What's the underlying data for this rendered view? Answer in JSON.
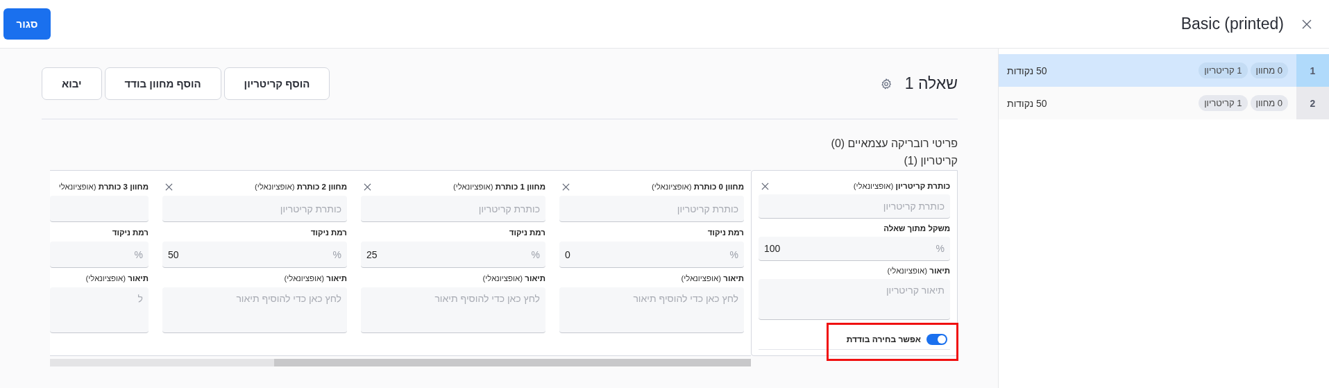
{
  "header": {
    "title": "Basic (printed)",
    "close_button": "סגור"
  },
  "sidebar": {
    "items": [
      {
        "number": "1",
        "tags": [
          "0 מחוון",
          "1 קריטריון"
        ],
        "points": "50 נקודות",
        "selected": true
      },
      {
        "number": "2",
        "tags": [
          "0 מחוון",
          "1 קריטריון"
        ],
        "points": "50 נקודות",
        "selected": false
      }
    ]
  },
  "question": {
    "title": "שאלה 1",
    "buttons": [
      "הוסף קריטריון",
      "הוסף מחוון בודד",
      "יבוא"
    ],
    "independent_items": "פריטי רובריקה עצמאיים (0)",
    "criteria_heading": "קריטריון (1)"
  },
  "criterion_card": {
    "fields": [
      {
        "kind": "text",
        "label": "כותרת קריטריון",
        "note": "(אופציונאלי)",
        "placeholder": "כותרת קריטריון"
      },
      {
        "kind": "percent",
        "label": "משקל מתוך שאלה",
        "value": "100",
        "unit": "%"
      },
      {
        "kind": "textarea",
        "label": "תיאור",
        "note": "(אופציונאלי)",
        "placeholder": "תיאור קריטריון"
      }
    ],
    "toggle": {
      "label": "אפשר בחירה בודדת",
      "on": true,
      "highlighted": true
    }
  },
  "level_cards": [
    {
      "kind": "full",
      "fields": [
        {
          "kind": "text",
          "label": "מחוון 0 כותרת",
          "note": "(אופציונאלי)",
          "placeholder": "כותרת קריטריון"
        },
        {
          "kind": "percent",
          "label": "רמת ניקוד",
          "value": "0",
          "unit": "%"
        },
        {
          "kind": "textarea",
          "label": "תיאור",
          "note": "(אופציונאלי)",
          "placeholder": "לחץ כאן כדי להוסיף תיאור"
        }
      ]
    },
    {
      "kind": "full",
      "fields": [
        {
          "kind": "text",
          "label": "מחוון 1 כותרת",
          "note": "(אופציונאלי)",
          "placeholder": "כותרת קריטריון"
        },
        {
          "kind": "percent",
          "label": "רמת ניקוד",
          "value": "25",
          "unit": "%"
        },
        {
          "kind": "textarea",
          "label": "תיאור",
          "note": "(אופציונאלי)",
          "placeholder": "לחץ כאן כדי להוסיף תיאור"
        }
      ]
    },
    {
      "kind": "full",
      "fields": [
        {
          "kind": "text",
          "label": "מחוון 2 כותרת",
          "note": "(אופציונאלי)",
          "placeholder": "כותרת קריטריון"
        },
        {
          "kind": "percent",
          "label": "רמת ניקוד",
          "value": "50",
          "unit": "%"
        },
        {
          "kind": "textarea",
          "label": "תיאור",
          "note": "(אופציונאלי)",
          "placeholder": "לחץ כאן כדי להוסיף תיאור"
        }
      ]
    },
    {
      "kind": "partial",
      "fields": [
        {
          "kind": "text",
          "label": "מחוון 3 כותרת",
          "note": "(אופציונאלי"
        },
        {
          "kind": "percent",
          "label": "רמת ניקוד",
          "unit": "%"
        },
        {
          "kind": "textarea",
          "label": "תיאור",
          "note": "(אופציונאלי)",
          "placeholder": "ל"
        }
      ]
    }
  ]
}
